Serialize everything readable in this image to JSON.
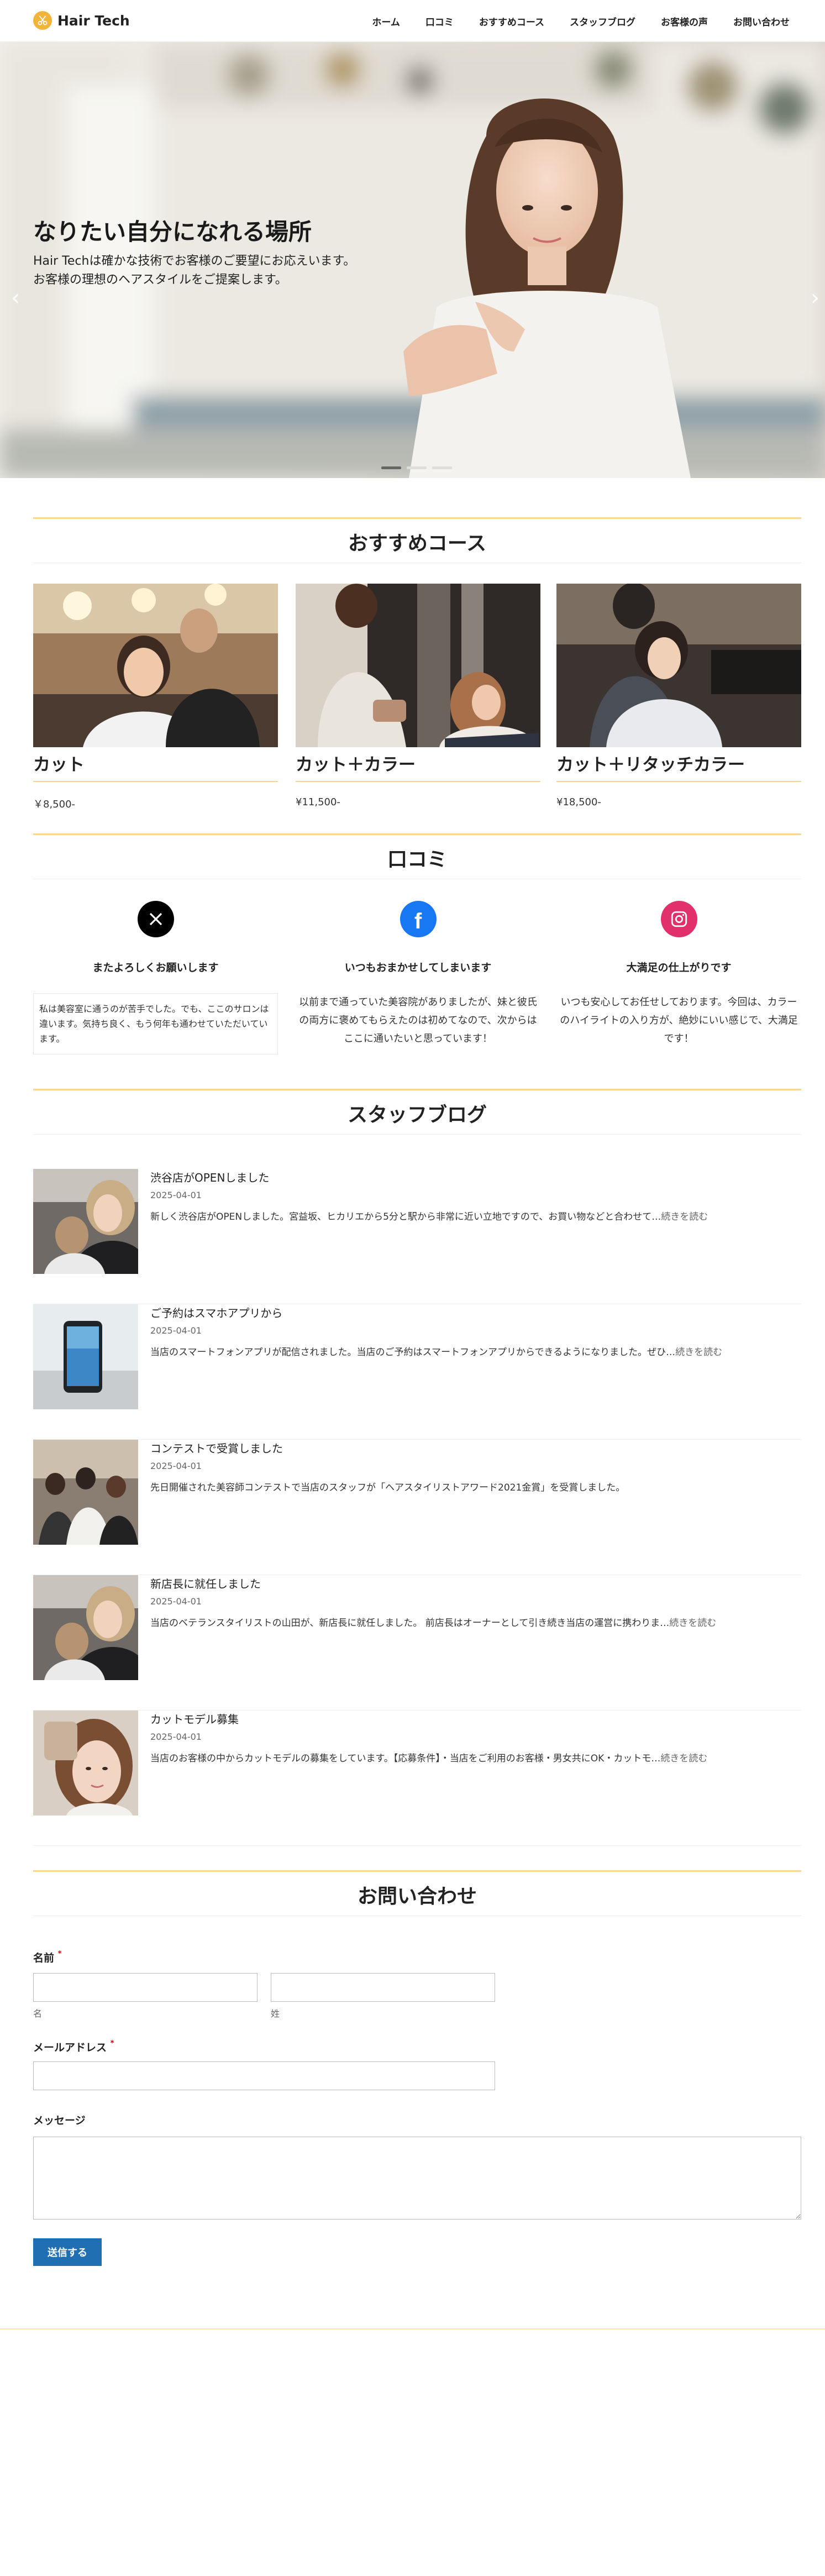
{
  "header": {
    "logo_text": "Hair Tech",
    "nav": [
      "ホーム",
      "口コミ",
      "おすすめコース",
      "スタッフブログ",
      "お客様の声",
      "お問い合わせ"
    ]
  },
  "hero": {
    "title": "なりたい自分になれる場所",
    "sub1": "Hair Techは確かな技術でお客様のご要望にお応えいます。",
    "sub2": "お客様の理想のヘアスタイルをご提案します。",
    "slides": 3,
    "active_slide": 1
  },
  "courses": {
    "title": "おすすめコース",
    "items": [
      {
        "name": "カット",
        "price": "￥8,500-"
      },
      {
        "name": "カット＋カラー",
        "price": "¥11,500-"
      },
      {
        "name": "カット＋リタッチカラー",
        "price": "¥18,500-"
      }
    ]
  },
  "reviews": {
    "title": "口コミ",
    "items": [
      {
        "icon": "x-icon",
        "color": "#000000",
        "title": "またよろしくお願いします",
        "body": "私は美容室に通うのが苦手でした。でも、ここのサロンは違います。気持ち良く、もう何年も通わせていただいています。"
      },
      {
        "icon": "facebook-icon",
        "color": "#1877f2",
        "title": "いつもおまかせしてしまいます",
        "body": "以前まで通っていた美容院がありましたが、妹と彼氏の両方に褒めてもらえたのは初めてなので、次からはここに通いたいと思っています！"
      },
      {
        "icon": "instagram-icon",
        "color": "#e1306c",
        "title": "大満足の仕上がりです",
        "body": "いつも安心してお任せしております。今回は、カラーのハイライトの入り方が、絶妙にいい感じで、大満足です！"
      }
    ]
  },
  "blog": {
    "title": "スタッフブログ",
    "more": "続きを読む",
    "posts": [
      {
        "title": "渋谷店がOPENしました",
        "date": "2025-04-01",
        "excerpt": "新しく渋谷店がOPENしました。宮益坂、ヒカリエから5分と駅から非常に近い立地ですので、お買い物などと合わせて…",
        "more": "続きを読む"
      },
      {
        "title": "ご予約はスマホアプリから",
        "date": "2025-04-01",
        "excerpt": "当店のスマートフォンアプリが配信されました。当店のご予約はスマートフォンアプリからできるようになりました。ぜひ…",
        "more": "続きを読む"
      },
      {
        "title": "コンテストで受賞しました",
        "date": "2025-04-01",
        "excerpt": "先日開催された美容師コンテストで当店のスタッフが「ヘアスタイリストアワード2021金賞」を受賞しました。",
        "more": ""
      },
      {
        "title": "新店長に就任しました",
        "date": "2025-04-01",
        "excerpt": "当店のベテランスタイリストの山田が、新店長に就任しました。 前店長はオーナーとして引き続き当店の運営に携わりま…",
        "more": "続きを読む"
      },
      {
        "title": "カットモデル募集",
        "date": "2025-04-01",
        "excerpt": "当店のお客様の中からカットモデルの募集をしています。【応募条件】・当店をご利用のお客様・男女共にOK・カットモ…",
        "more": "続きを読む"
      }
    ]
  },
  "contact": {
    "title": "お問い合わせ",
    "name_label": "名前",
    "required": "*",
    "first_label": "名",
    "last_label": "姓",
    "email_label": "メールアドレス",
    "message_label": "メッセージ",
    "submit": "送信する"
  },
  "colors": {
    "accent": "#f7d796",
    "logo": "#f2b43b",
    "button": "#1f6fb2"
  }
}
